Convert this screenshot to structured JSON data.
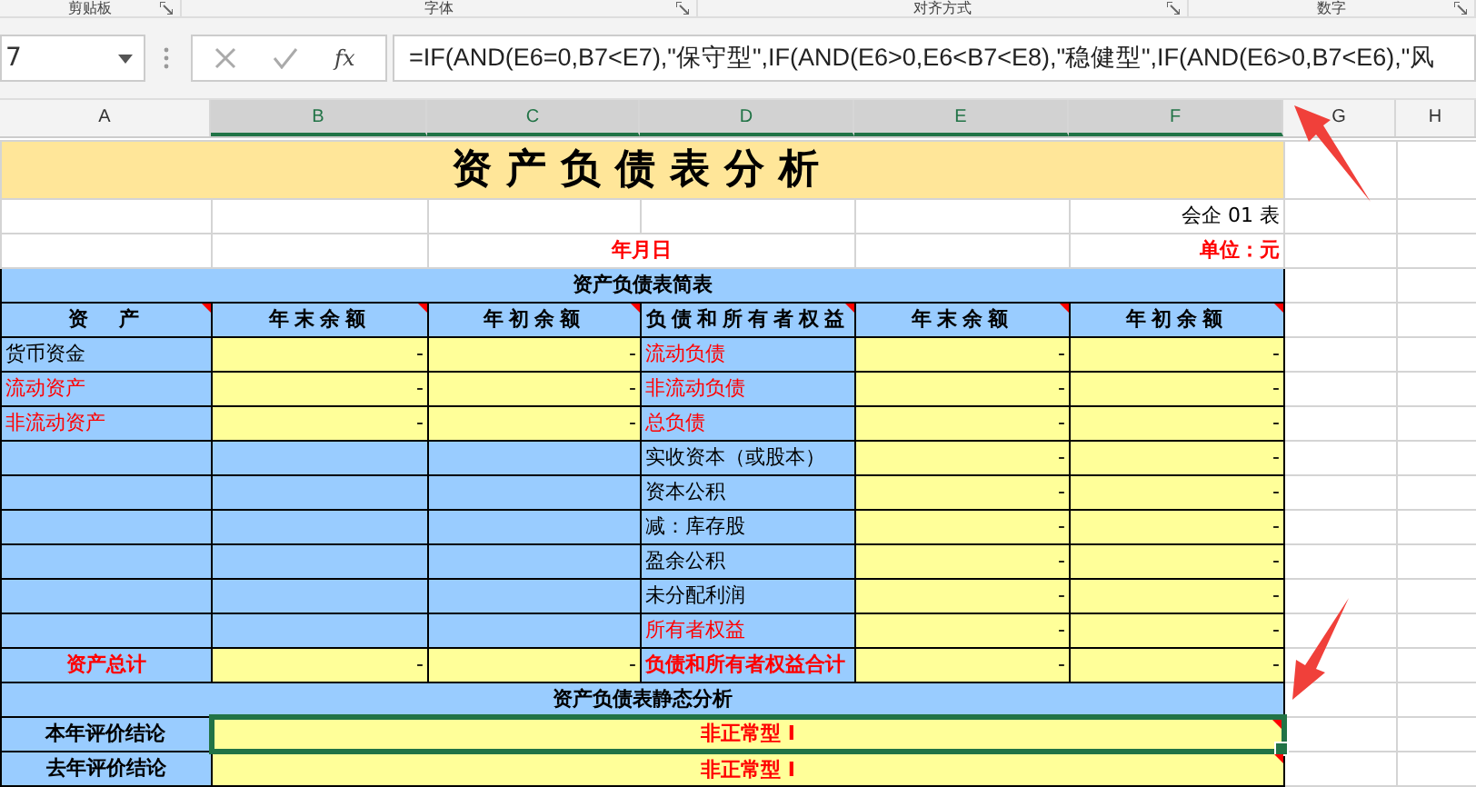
{
  "ribbon_groups": [
    "剪贴板",
    "字体",
    "对齐方式",
    "数字"
  ],
  "formula_bar": {
    "name_box": "7",
    "function_label": "fx",
    "formula": "=IF(AND(E6=0,B7<E7),\"保守型\",IF(AND(E6>0,E6<B7<E8),\"稳健型\",IF(AND(E6>0,B7<E6),\"风"
  },
  "columns": [
    {
      "label": "A",
      "selected": false
    },
    {
      "label": "B",
      "selected": true
    },
    {
      "label": "C",
      "selected": true
    },
    {
      "label": "D",
      "selected": true
    },
    {
      "label": "E",
      "selected": true
    },
    {
      "label": "F",
      "selected": true
    },
    {
      "label": "G",
      "selected": false
    },
    {
      "label": "H",
      "selected": false
    }
  ],
  "sheet": {
    "title": "资产负债表分析",
    "form_no": "会企 01 表",
    "date": "年月日",
    "unit": "单位：元",
    "table_title": "资产负债表简表",
    "headers": [
      {
        "label": "资　产",
        "has_comment": true
      },
      {
        "label": "年末余额",
        "has_comment": true
      },
      {
        "label": "年初余额",
        "has_comment": true
      },
      {
        "label": "负债和所有者权益",
        "has_comment": true
      },
      {
        "label": "年末余额",
        "has_comment": true
      },
      {
        "label": "年初余额",
        "has_comment": true
      }
    ],
    "rows": [
      {
        "asset": "货币资金",
        "asset_highlighted": false,
        "asset_end": "-",
        "asset_begin": "-",
        "liability": "流动负债",
        "liability_highlighted": true,
        "liability_end": "-",
        "liability_begin": "-"
      },
      {
        "asset": "流动资产",
        "asset_highlighted": true,
        "asset_end": "-",
        "asset_begin": "-",
        "liability": "非流动负债",
        "liability_highlighted": true,
        "liability_end": "-",
        "liability_begin": "-"
      },
      {
        "asset": "非流动资产",
        "asset_highlighted": true,
        "asset_end": "-",
        "asset_begin": "-",
        "liability": "总负债",
        "liability_highlighted": true,
        "liability_end": "-",
        "liability_begin": "-"
      },
      {
        "liability": "实收资本（或股本）",
        "liability_highlighted": false,
        "liability_end": "-",
        "liability_begin": "-"
      },
      {
        "liability": "资本公积",
        "liability_highlighted": false,
        "liability_end": "-",
        "liability_begin": "-"
      },
      {
        "liability": "减：库存股",
        "liability_highlighted": false,
        "liability_end": "-",
        "liability_begin": "-"
      },
      {
        "liability": "盈余公积",
        "liability_highlighted": false,
        "liability_end": "-",
        "liability_begin": "-"
      },
      {
        "liability": "未分配利润",
        "liability_highlighted": false,
        "liability_end": "-",
        "liability_begin": "-"
      },
      {
        "liability": "所有者权益",
        "liability_highlighted": true,
        "liability_end": "-",
        "liability_begin": "-"
      }
    ],
    "total": {
      "asset": "资产总计",
      "asset_end": "-",
      "asset_begin": "-",
      "liability": "负债和所有者权益合计",
      "liability_end": "-",
      "liability_begin": "-"
    },
    "analysis_title": "资产负债表静态分析",
    "conclusions": [
      {
        "label": "本年评价结论",
        "value": "非正常型 I",
        "selected": true,
        "has_comment": true
      },
      {
        "label": "去年评价结论",
        "value": "非正常型 I",
        "selected": false,
        "has_comment": true
      }
    ]
  }
}
